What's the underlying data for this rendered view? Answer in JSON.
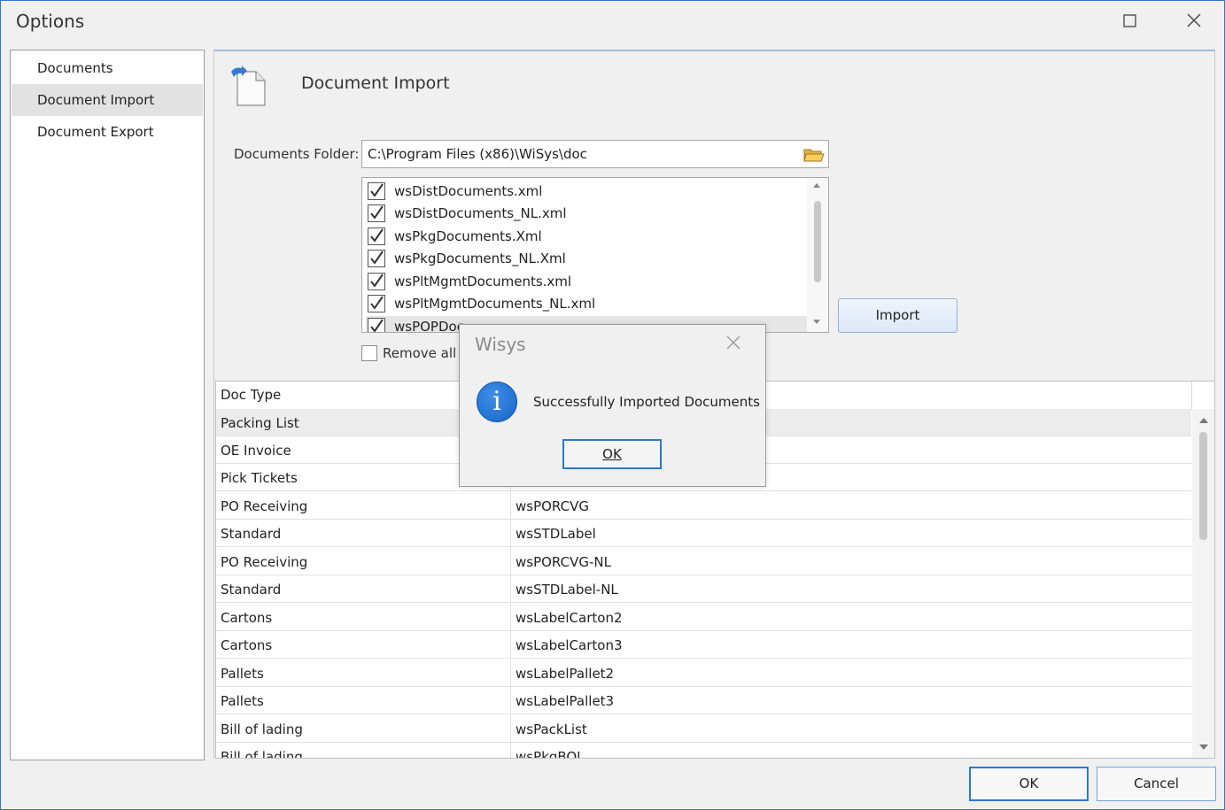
{
  "window": {
    "title": "Options",
    "maximize_icon": "maximize-icon",
    "close_icon": "close-icon"
  },
  "nav": {
    "items": [
      {
        "label": "Documents",
        "selected": false
      },
      {
        "label": "Document Import",
        "selected": true
      },
      {
        "label": "Document Export",
        "selected": false
      }
    ]
  },
  "panel": {
    "title": "Document Import",
    "folder_label": "Documents Folder:",
    "folder_value": "C:\\Program Files (x86)\\WiSys\\doc",
    "files": [
      {
        "name": "wsDistDocuments.xml",
        "checked": true
      },
      {
        "name": "wsDistDocuments_NL.xml",
        "checked": true
      },
      {
        "name": "wsPkgDocuments.Xml",
        "checked": true
      },
      {
        "name": "wsPkgDocuments_NL.Xml",
        "checked": true
      },
      {
        "name": "wsPltMgmtDocuments.xml",
        "checked": true
      },
      {
        "name": "wsPltMgmtDocuments_NL.xml",
        "checked": true
      },
      {
        "name": "wsPOPDoc",
        "checked": true
      }
    ],
    "import_label": "Import",
    "remove_label": "Remove all"
  },
  "grid": {
    "header": "Doc Type",
    "rows": [
      {
        "type": "Packing List",
        "name": ""
      },
      {
        "type": "OE Invoice",
        "name": ""
      },
      {
        "type": "Pick Tickets",
        "name": ""
      },
      {
        "type": "PO Receiving",
        "name": "wsPORCVG"
      },
      {
        "type": "Standard",
        "name": "wsSTDLabel"
      },
      {
        "type": "PO Receiving",
        "name": "wsPORCVG-NL"
      },
      {
        "type": "Standard",
        "name": "wsSTDLabel-NL"
      },
      {
        "type": "Cartons",
        "name": "wsLabelCarton2"
      },
      {
        "type": "Cartons",
        "name": "wsLabelCarton3"
      },
      {
        "type": "Pallets",
        "name": "wsLabelPallet2"
      },
      {
        "type": "Pallets",
        "name": "wsLabelPallet3"
      },
      {
        "type": "Bill of lading",
        "name": "wsPackList"
      },
      {
        "type": "Bill of lading",
        "name": "wsPkgBOL"
      }
    ]
  },
  "footer": {
    "ok_label": "OK",
    "cancel_label": "Cancel"
  },
  "messagebox": {
    "title": "Wisys",
    "message": "Successfully Imported Documents",
    "ok_label": "OK",
    "icon": "info-icon",
    "icon_glyph": "i"
  },
  "colors": {
    "accent": "#2b79d0",
    "info": "#1565c8"
  }
}
